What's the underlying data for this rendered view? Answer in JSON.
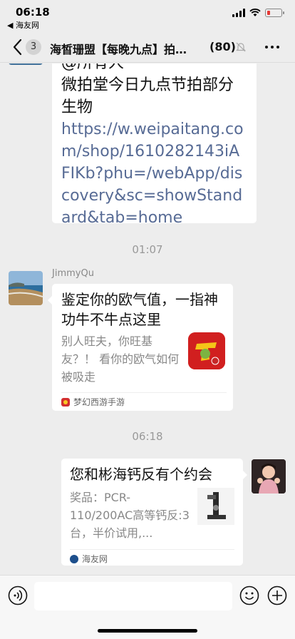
{
  "status_bar": {
    "time": "06:18",
    "back_app": "◀ 海友网"
  },
  "nav": {
    "unread_count": "3",
    "title": "海皙珊盟【每晚九点】拍…",
    "member_count": "(80)"
  },
  "messages": {
    "top": {
      "mention_partial": "@所有人",
      "text": "微拍堂今日九点节拍部分生物",
      "link": "https://w.weipaitang.com/shop/1610282143iAFIKb?phu=/webApp/discovery&sc=showStandard&tab=home"
    },
    "time_1": "01:07",
    "jimmy": {
      "sender": "JimmyQu",
      "title": "鉴定你的欧气值，一指神功牛不牛点这里",
      "desc": "别人旺夫，你旺基友？！ 看你的欧气如何被吸走",
      "source": "梦幻西游手游"
    },
    "time_2": "06:18",
    "own": {
      "title": "您和彬海钙反有个约会",
      "desc": "奖品：PCR-110/200AC高等钙反:3台，半价试用,...",
      "source": "海友网"
    }
  },
  "icons": {
    "back": "chevron-left-icon",
    "mute": "bell-off-icon",
    "more": "more-icon",
    "voice": "voice-icon",
    "emoji": "emoji-icon",
    "plus": "plus-icon"
  },
  "colors": {
    "background": "#ededed",
    "link": "#576b95",
    "bubble": "#ffffff",
    "battery_low": "#e53935"
  }
}
